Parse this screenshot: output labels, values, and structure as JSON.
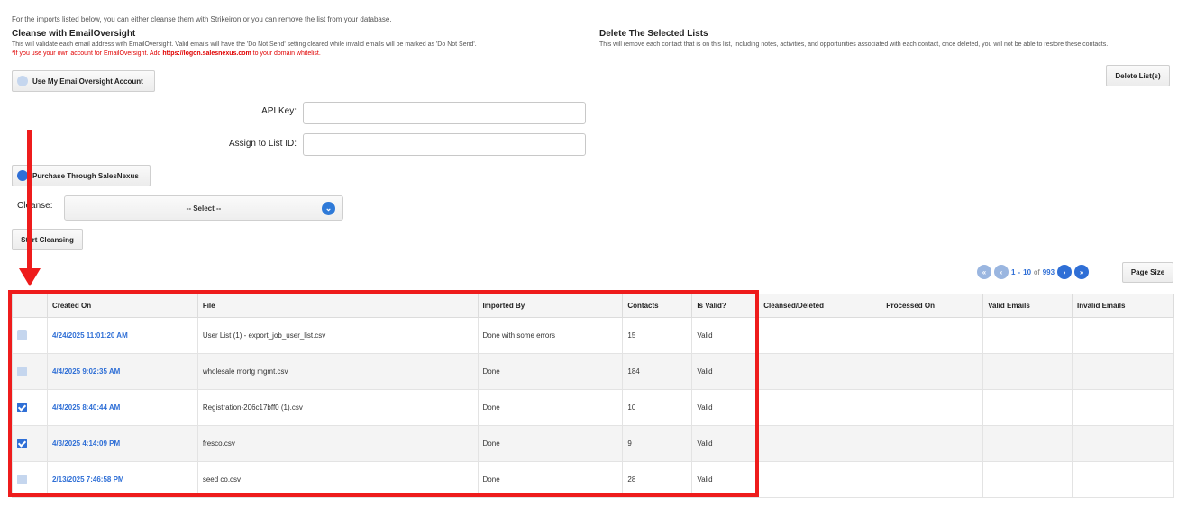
{
  "intro_text": "For the imports listed below, you can either cleanse them with Strikeiron or you can remove the list from your database.",
  "cleanse": {
    "title": "Cleanse with EmailOversight",
    "description": "This will validate each email address with EmailOversight. Valid emails will have the 'Do Not Send' setting cleared while invalid emails will be marked as 'Do Not Send'.",
    "note_prefix": "*If you use your own account for EmailOversight. Add ",
    "note_link": "https://logon.salesnexus.com",
    "note_suffix": " to your domain whitelist.",
    "own_account_label": "Use My EmailOversight Account",
    "api_key_label": "API Key:",
    "api_key_value": "",
    "list_id_label": "Assign to List ID:",
    "list_id_value": "",
    "purchase_label": "Purchase Through SalesNexus",
    "cleanse_label": "Cleanse:",
    "cleanse_select": "-- Select --",
    "start_label": "Start Cleansing"
  },
  "delete": {
    "title": "Delete The Selected Lists",
    "description": "This will remove each contact that is on this list, Including notes, activities, and opportunities associated with each contact, once deleted, you will not be able to restore these contacts.",
    "button_label": "Delete List(s)"
  },
  "pager": {
    "from": "1",
    "dash": "-",
    "to": "10",
    "of_label": "of",
    "total": "993",
    "page_size_label": "Page Size"
  },
  "table": {
    "headers": [
      "",
      "Created On",
      "File",
      "Imported By",
      "Contacts",
      "Is Valid?",
      "Cleansed/Deleted",
      "Processed On",
      "Valid Emails",
      "Invalid Emails"
    ],
    "rows": [
      {
        "checked": false,
        "created": "4/24/2025 11:01:20 AM",
        "file": "User List (1) - export_job_user_list.csv",
        "imported_by": "Done with some errors",
        "contacts": "15",
        "valid": "Valid"
      },
      {
        "checked": false,
        "created": "4/4/2025 9:02:35 AM",
        "file": "wholesale mortg mgmt.csv",
        "imported_by": "Done",
        "contacts": "184",
        "valid": "Valid"
      },
      {
        "checked": true,
        "created": "4/4/2025 8:40:44 AM",
        "file": "Registration-206c17bff0 (1).csv",
        "imported_by": "Done",
        "contacts": "10",
        "valid": "Valid"
      },
      {
        "checked": true,
        "created": "4/3/2025 4:14:09 PM",
        "file": "fresco.csv",
        "imported_by": "Done",
        "contacts": "9",
        "valid": "Valid"
      },
      {
        "checked": false,
        "created": "2/13/2025 7:46:58 PM",
        "file": "seed co.csv",
        "imported_by": "Done",
        "contacts": "28",
        "valid": "Valid"
      }
    ]
  },
  "colors": {
    "accent": "#2f6fd6",
    "annotation": "#ee1c1c"
  }
}
